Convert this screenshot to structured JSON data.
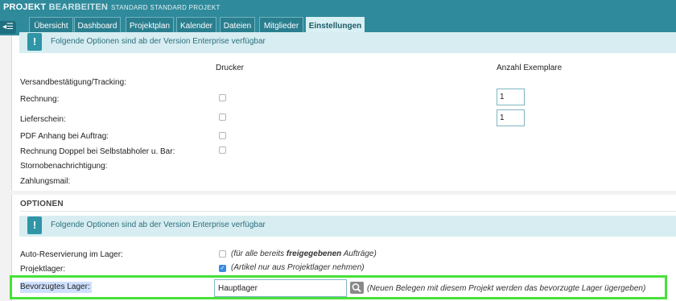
{
  "header": {
    "title_main": "PROJEKT",
    "title_sub": "BEARBEITEN",
    "subtitle": "STANDARD STANDARD PROJEKT",
    "toggle_icon": "sidebar-toggle-icon"
  },
  "tabs": [
    {
      "label": "Übersicht",
      "active": false
    },
    {
      "label": "Dashboard",
      "active": false
    },
    {
      "label": "Projektplan",
      "active": false
    },
    {
      "label": "Kalender",
      "active": false
    },
    {
      "label": "Dateien",
      "active": false
    },
    {
      "label": "Mitglieder",
      "active": false
    },
    {
      "label": "Einstellungen",
      "active": true
    }
  ],
  "upper": {
    "notice": "Folgende Optionen sind ab der Version Enterprise verfügbar",
    "col_drucker": "Drucker",
    "col_anzahl": "Anzahl Exemplare",
    "rows": [
      {
        "label": "Versandbestätigung/Tracking:"
      },
      {
        "label": "Rechnung:",
        "checked": false,
        "copies": "1"
      },
      {
        "label": "Lieferschein:",
        "checked": false,
        "copies": "1"
      },
      {
        "label": "PDF Anhang bei Auftrag:",
        "checked": false
      },
      {
        "label": "Rechnung Doppel bei Selbstabholer u. Bar:",
        "checked": false
      },
      {
        "label": "Stornobenachrichtigung:"
      },
      {
        "label": "Zahlungsmail:"
      }
    ]
  },
  "options": {
    "title": "OPTIONEN",
    "notice": "Folgende Optionen sind ab der Version Enterprise verfügbar",
    "auto_res_label": "Auto-Reservierung im Lager:",
    "auto_res_checked": false,
    "auto_res_hint_pre": "(für alle bereits ",
    "auto_res_hint_bold": "freigegebenen",
    "auto_res_hint_post": " Aufträge)",
    "projektlager_label": "Projektlager:",
    "projektlager_checked": true,
    "projektlager_hint": "(Artikel nur aus Projektlager nehmen)",
    "lager_label": "Bevorzugtes Lager:",
    "lager_value": "Hauptlager",
    "lager_hint": "(Neuen Belegen mit diesem Projekt werden das bevorzugte Lager ügergeben)"
  },
  "colors": {
    "header_bg": "#2f8a9b",
    "highlight": "#49e03a",
    "checkbox_checked": "#3b8be0"
  }
}
